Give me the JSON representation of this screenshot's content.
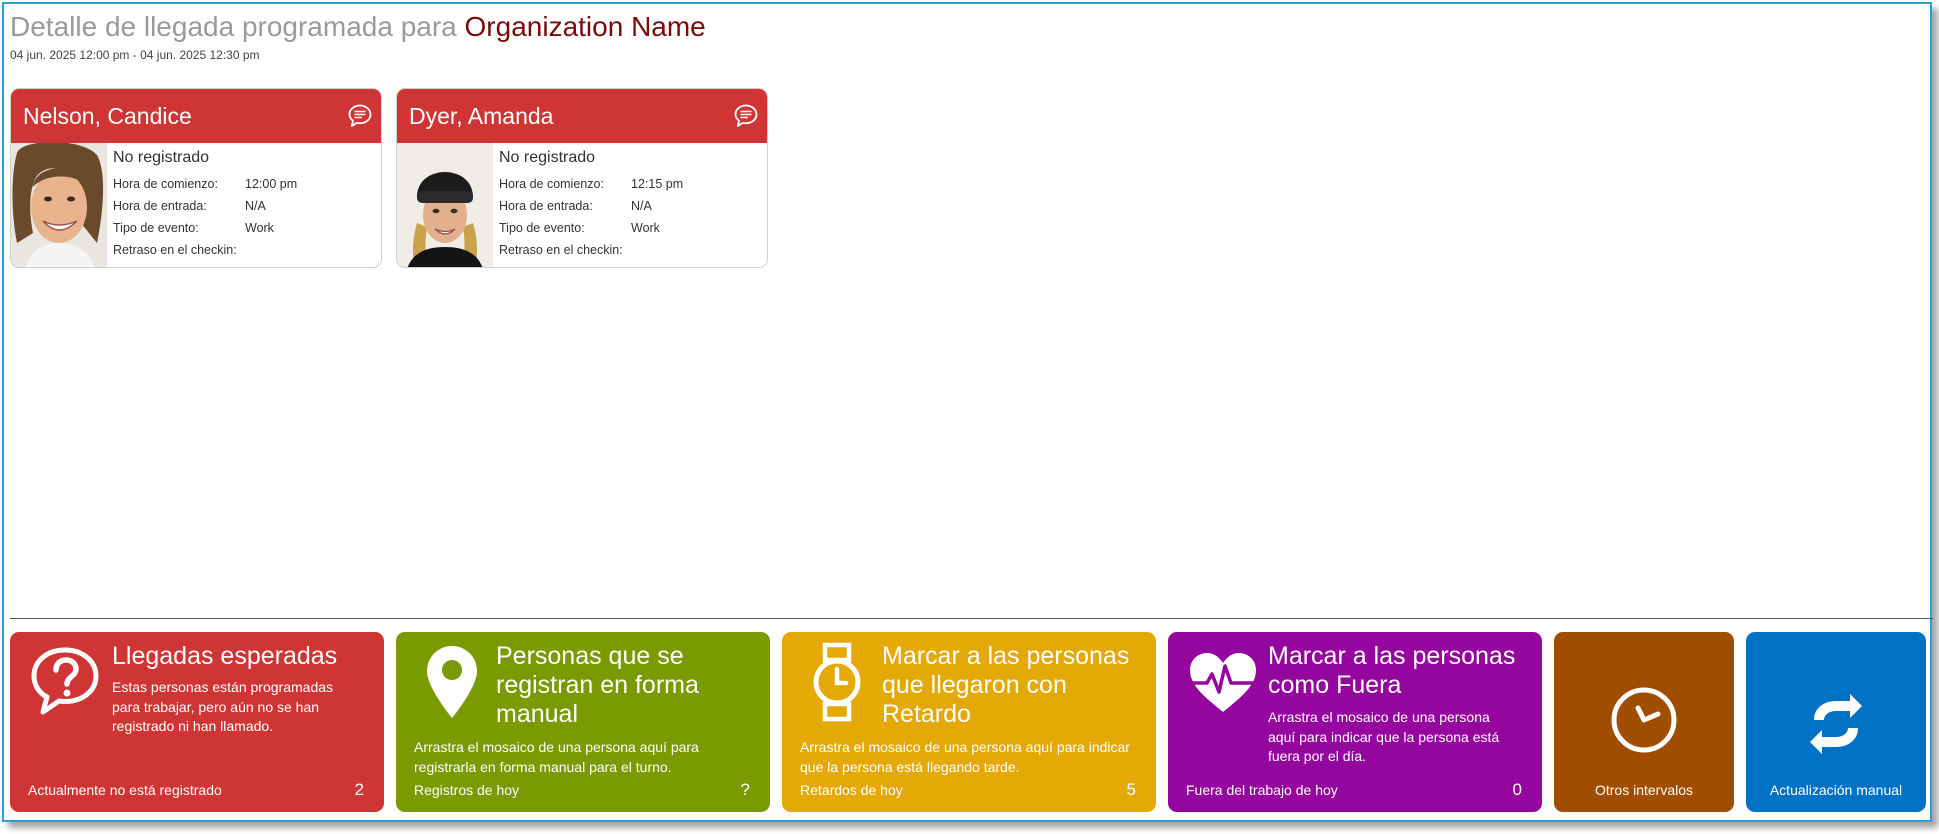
{
  "header": {
    "title_prefix": "Detalle de llegada programada para ",
    "org_name": "Organization Name",
    "date_range": "04 jun. 2025 12:00 pm - 04 jun. 2025 12:30 pm"
  },
  "labels": {
    "start_time": "Hora de comienzo:",
    "entry_time": "Hora de entrada:",
    "event_type": "Tipo de evento:",
    "checkin_delay": "Retraso en el checkin:"
  },
  "people": [
    {
      "name": "Nelson, Candice",
      "status": "No registrado",
      "start_time": "12:00 pm",
      "entry_time": "N/A",
      "event_type": "Work",
      "checkin_delay": ""
    },
    {
      "name": "Dyer, Amanda",
      "status": "No registrado",
      "start_time": "12:15 pm",
      "entry_time": "N/A",
      "event_type": "Work",
      "checkin_delay": ""
    }
  ],
  "tiles": {
    "expected": {
      "title": "Llegadas esperadas",
      "description": "Estas personas están programadas para trabajar, pero aún no se han registrado ni han llamado.",
      "footer": "Actualmente no está registrado",
      "count": "2",
      "color": "#cf3535",
      "icon": "question-bubble-icon"
    },
    "manual_checkin": {
      "title": "Personas que se registran en forma manual",
      "description": "Arrastra el mosaico de una persona aquí para registrarla en forma manual para el turno.",
      "footer": "Registros de hoy",
      "count": "?",
      "color": "#7a9a01",
      "icon": "map-pin-icon"
    },
    "late": {
      "title": "Marcar a las personas que llegaron con Retardo",
      "description": "Arrastra el mosaico de una persona aquí para indicar que la persona está llegando tarde.",
      "footer": "Retardos de hoy",
      "count": "5",
      "color": "#e4a906",
      "icon": "watch-icon"
    },
    "out": {
      "title": "Marcar a las personas como Fuera",
      "description": "Arrastra el mosaico de una persona aquí para indicar que la persona está fuera por el día.",
      "footer": "Fuera del trabajo de hoy",
      "count": "0",
      "color": "#94069e",
      "icon": "heartbeat-icon"
    },
    "other_intervals": {
      "footer": "Otros intervalos",
      "color": "#a04d00",
      "icon": "clock-icon"
    },
    "manual_refresh": {
      "footer": "Actualización manual",
      "color": "#0072c6",
      "icon": "refresh-icon"
    }
  }
}
